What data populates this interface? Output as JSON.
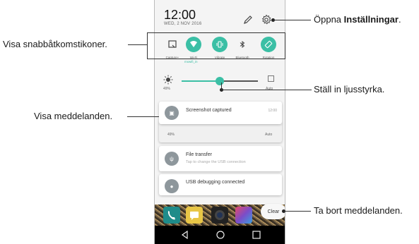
{
  "status": {
    "time": "12:00",
    "date": "WED, 2 NOV 2016"
  },
  "quick_settings": {
    "tiles": [
      {
        "label": "Capture+",
        "icon": "capture-plus-icon",
        "active": false
      },
      {
        "label": "Wi-Fi",
        "icon": "wifi-icon",
        "active": true,
        "sub": "mxwifi_in"
      },
      {
        "label": "Vibrate",
        "icon": "vibrate-icon",
        "active": true
      },
      {
        "label": "Bluetooth",
        "icon": "bluetooth-icon",
        "active": false
      },
      {
        "label": "Rotation",
        "icon": "rotation-icon",
        "active": true
      }
    ]
  },
  "brightness": {
    "level_label": "49%",
    "auto_label": "Auto",
    "value": 0.5
  },
  "notifications": [
    {
      "title": "Screenshot captured",
      "time": "12:00",
      "icon": "image-icon"
    },
    {
      "title": "File transfer",
      "text": "Tap to change the USB connection",
      "icon": "usb-icon"
    },
    {
      "title": "USB debugging connected",
      "text": "",
      "icon": "android-icon"
    }
  ],
  "behind_card": {
    "level": "49%",
    "auto": "Auto"
  },
  "clear_label": "Clear",
  "callouts": {
    "settings_pre": "Öppna ",
    "settings_bold": "Inställningar",
    "settings_post": ".",
    "quick_settings": "Visa snabbåtkomstikoner.",
    "brightness": "Ställ in ljusstyrka.",
    "notifications": "Visa meddelanden.",
    "clear": "Ta bort meddelanden."
  },
  "colors": {
    "accent": "#3bbfa5",
    "callout_bracket": "#333333"
  }
}
